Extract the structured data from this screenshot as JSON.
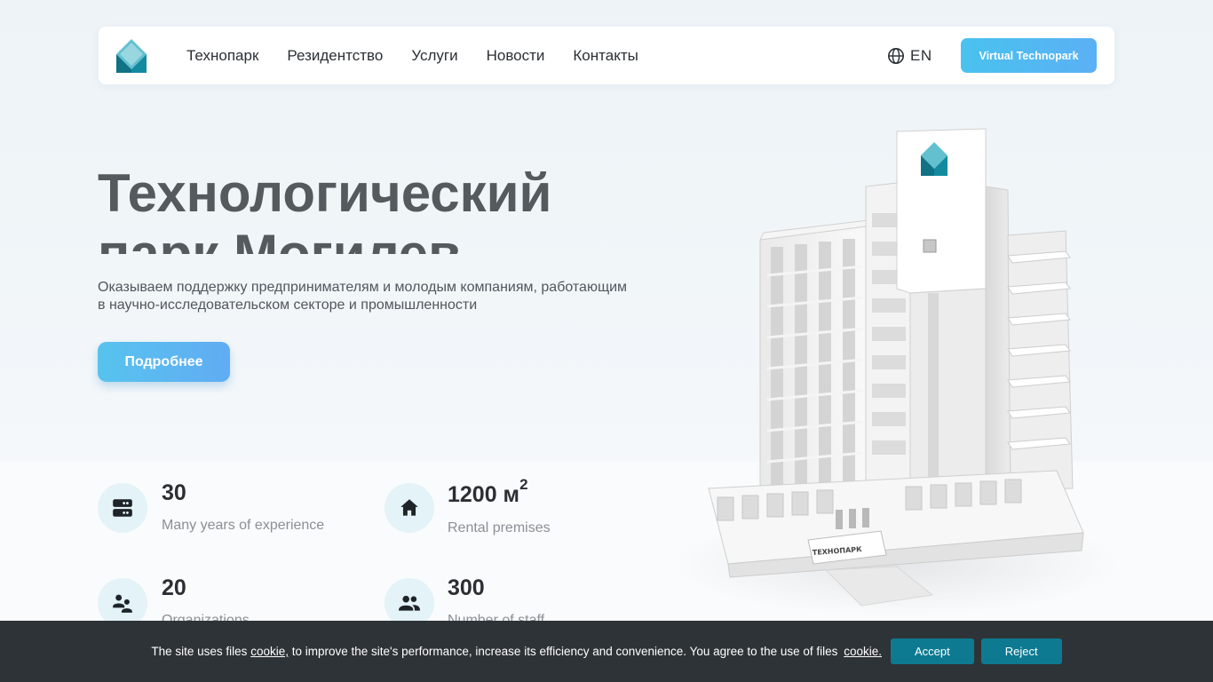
{
  "header": {
    "nav": [
      {
        "label": "Технопарк"
      },
      {
        "label": "Резидентство"
      },
      {
        "label": "Услуги"
      },
      {
        "label": "Новости"
      },
      {
        "label": "Контакты"
      }
    ],
    "lang": "EN",
    "cta": "Virtual Technopark"
  },
  "hero": {
    "title_line1": "Технологический",
    "title_line2": "парк Могилев",
    "subtitle_line1": "Оказываем поддержку предпринимателям и молодым компаниям, работающим",
    "subtitle_line2": "в научно-исследовательском секторе и промышленности",
    "button": "Подробнее"
  },
  "stats": [
    {
      "value": "30",
      "label": "Many years of experience",
      "icon": "server-icon"
    },
    {
      "value": "1200 м",
      "sup": "2",
      "label": "Rental premises",
      "icon": "home-icon"
    },
    {
      "value": "20",
      "label": "Organizations",
      "icon": "user-group-icon"
    },
    {
      "value": "300",
      "label": "Number of staff",
      "icon": "users-icon"
    }
  ],
  "building": {
    "sign": "ТЕХНОПАРК"
  },
  "cookie": {
    "text1": "The site uses files",
    "link1": "cookie,",
    "text2": "to improve the site's performance, increase its efficiency and convenience. You agree to the use of files",
    "link2": "cookie.",
    "accept": "Accept",
    "reject": "Reject"
  },
  "colors": {
    "accent": "#4fbcee",
    "teal": "#0d7a91",
    "cookie_bg": "#2e3337"
  }
}
